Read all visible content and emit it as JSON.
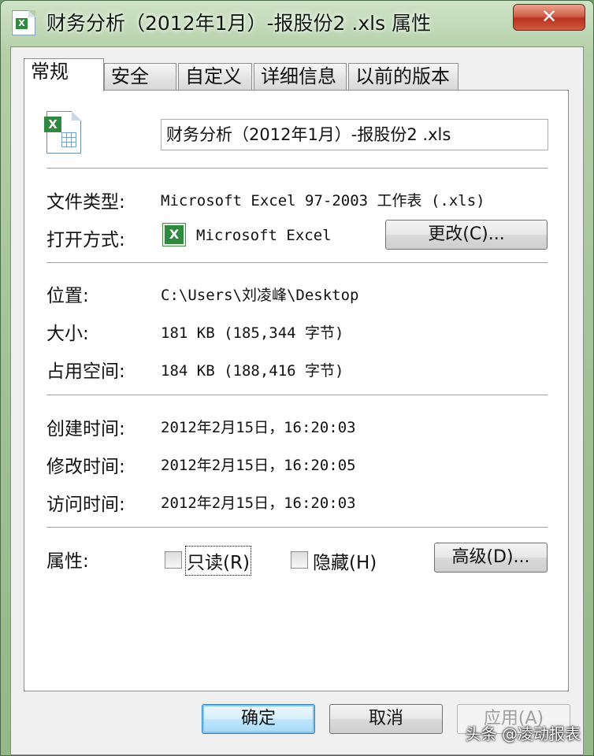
{
  "window": {
    "title": "财务分析（2012年1月）-报股份2 .xls 属性",
    "close_glyph": "✕",
    "accent": "#9ebf92",
    "close_color": "#c9402b"
  },
  "tabs": [
    {
      "label": "常规",
      "active": true
    },
    {
      "label": "安全",
      "active": false
    },
    {
      "label": "自定义",
      "active": false
    },
    {
      "label": "详细信息",
      "active": false
    },
    {
      "label": "以前的版本",
      "active": false
    }
  ],
  "general": {
    "file_icon": "excel-file-icon",
    "file_name": "财务分析（2012年1月）-报股份2 .xls",
    "type_label": "文件类型:",
    "type_value": "Microsoft Excel 97-2003 工作表 (.xls)",
    "opens_label": "打开方式:",
    "opens_icon": "excel-app-icon",
    "opens_value": "Microsoft Excel",
    "change_button": "更改(C)...",
    "location_label": "位置:",
    "location_value": "C:\\Users\\刘凌峰\\Desktop",
    "size_label": "大小:",
    "size_value": "181 KB (185,344 字节)",
    "size_on_disk_label": "占用空间:",
    "size_on_disk_value": "184 KB (188,416 字节)",
    "created_label": "创建时间:",
    "created_value": "2012年2月15日，16:20:03",
    "modified_label": "修改时间:",
    "modified_value": "2012年2月15日，16:20:05",
    "accessed_label": "访问时间:",
    "accessed_value": "2012年2月15日，16:20:03",
    "attributes_label": "属性:",
    "readonly_label": "只读(R)",
    "readonly_checked": false,
    "hidden_label": "隐藏(H)",
    "hidden_checked": false,
    "advanced_button": "高级(D)..."
  },
  "footer": {
    "ok": "确定",
    "cancel": "取消",
    "apply": "应用(A)"
  },
  "watermark": "头条 @凌动报表"
}
